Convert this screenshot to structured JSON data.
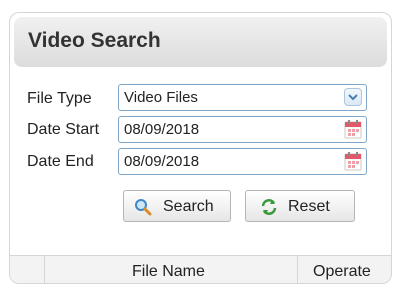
{
  "panel": {
    "title": "Video Search"
  },
  "form": {
    "file_type": {
      "label": "File Type",
      "value": "Video Files"
    },
    "date_start": {
      "label": "Date Start",
      "value": "08/09/2018"
    },
    "date_end": {
      "label": "Date End",
      "value": "08/09/2018"
    }
  },
  "buttons": {
    "search": "Search",
    "reset": "Reset"
  },
  "table": {
    "columns": [
      "File Name",
      "Operate"
    ]
  },
  "icons": {
    "select_arrow": "chevron-down-icon",
    "calendar": "calendar-icon",
    "search": "magnifier-icon",
    "reset": "refresh-icon"
  },
  "colors": {
    "field_border": "#7fa6c9",
    "header_bg": "#e3e3e3",
    "calendar_red": "#e05a6a"
  }
}
